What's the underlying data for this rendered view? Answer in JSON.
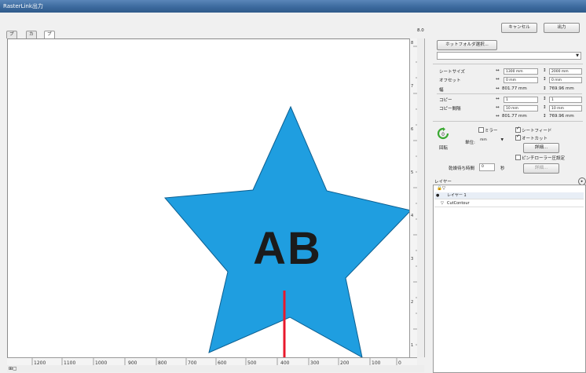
{
  "window": {
    "title": "RasterLink出力"
  },
  "tabs": [
    "プリント",
    "カット",
    "プリント&カット"
  ],
  "header": {
    "zoom_value": "8.0",
    "cancel_label": "キャンセル",
    "output_label": "出力"
  },
  "hotfolder": {
    "button_label": "ホットフォルダ選択..."
  },
  "settings": {
    "sheet_size_label": "シートサイズ",
    "sheet_w": "1300 mm",
    "sheet_h": "2000 mm",
    "offset_label": "オフセット",
    "offset_x": "0 mm",
    "offset_y": "0 mm",
    "width_label": "幅",
    "width_w": "801.77 mm",
    "width_h": "769.96 mm",
    "copy_label": "コピー",
    "copy_x": "1",
    "copy_y": "1",
    "copy_gap_label": "コピー間隔",
    "gap_x": "10 mm",
    "gap_y": "10 mm",
    "total_w": "801.77 mm",
    "total_h": "769.96 mm"
  },
  "transform": {
    "rotate_value": "0",
    "rotate_label": "回転",
    "mirror_label": "ミラー",
    "unit_label": "単位:",
    "unit_value": "mm",
    "sheet_feed_label": "シートフィード",
    "auto_cut_label": "オートカット",
    "detail_label": "詳細...",
    "pinch_label": "ピンチローラー圧設定",
    "dry_time_label": "乾燥待ち時間",
    "dry_time_value": "0",
    "seconds_label": "秒",
    "detail2_label": "詳細..."
  },
  "layers": {
    "panel_title": "レイヤー",
    "items": [
      "レイヤー 1",
      "CutContour"
    ]
  },
  "artwork": {
    "text": "AB",
    "fill": "#1f9ee0",
    "cut_line": "#e8192c"
  },
  "rulers": {
    "h_ticks": [
      "1200",
      "1100",
      "1000",
      "900",
      "800",
      "700",
      "600",
      "500",
      "400",
      "300",
      "200",
      "100",
      "0"
    ],
    "v_ticks": [
      "1",
      "2",
      "3",
      "4",
      "5",
      "6",
      "7",
      "8"
    ]
  }
}
